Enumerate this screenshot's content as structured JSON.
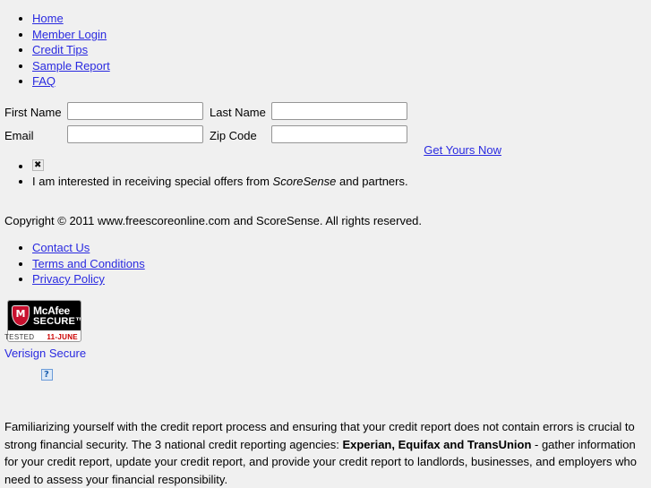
{
  "top_nav": {
    "items": [
      {
        "label": "Home"
      },
      {
        "label": "Member Login"
      },
      {
        "label": "Credit Tips"
      },
      {
        "label": "Sample Report"
      },
      {
        "label": "FAQ"
      }
    ]
  },
  "form": {
    "first_name_label": "First Name",
    "first_name_value": "",
    "last_name_label": "Last Name",
    "last_name_value": "",
    "email_label": "Email",
    "email_value": "",
    "zip_label": "Zip Code",
    "zip_value": "",
    "submit_label": "Get Yours Now"
  },
  "offers": {
    "checkbox_icon": "broken-image-icon",
    "checkbox_glyph": "✖",
    "text_before": "I am interested in receiving special offers from ",
    "brand": "ScoreSense",
    "text_after": " and partners."
  },
  "copyright": "Copyright © 2011 www.freescoreonline.com and ScoreSense. All rights reserved.",
  "footer_nav": {
    "items": [
      {
        "label": "Contact Us"
      },
      {
        "label": "Terms and Conditions"
      },
      {
        "label": "Privacy Policy"
      }
    ]
  },
  "badges": {
    "mcafee": {
      "shield_letter": "M",
      "word1": "McAfee",
      "word2": "SECURE™",
      "tested_label": "TESTED",
      "tested_date": "11-JUNE"
    },
    "verisign": {
      "label": "Verisign Secure",
      "image_glyph": "?"
    }
  },
  "info_paragraph": {
    "part1": "Familiarizing yourself with the credit report process and ensuring that your credit report does not contain errors is crucial to strong financial security. The 3 national credit reporting agencies: ",
    "bold": "Experian, Equifax and TransUnion",
    "part2": " - gather information for your credit report, update your credit report, and provide your credit report to landlords, businesses, and employers who need to assess your financial responsibility."
  },
  "colors": {
    "link": "#2a2ae0",
    "background": "#f0f0f0",
    "badge_red": "#c8102e",
    "date_red": "#cc0000"
  }
}
